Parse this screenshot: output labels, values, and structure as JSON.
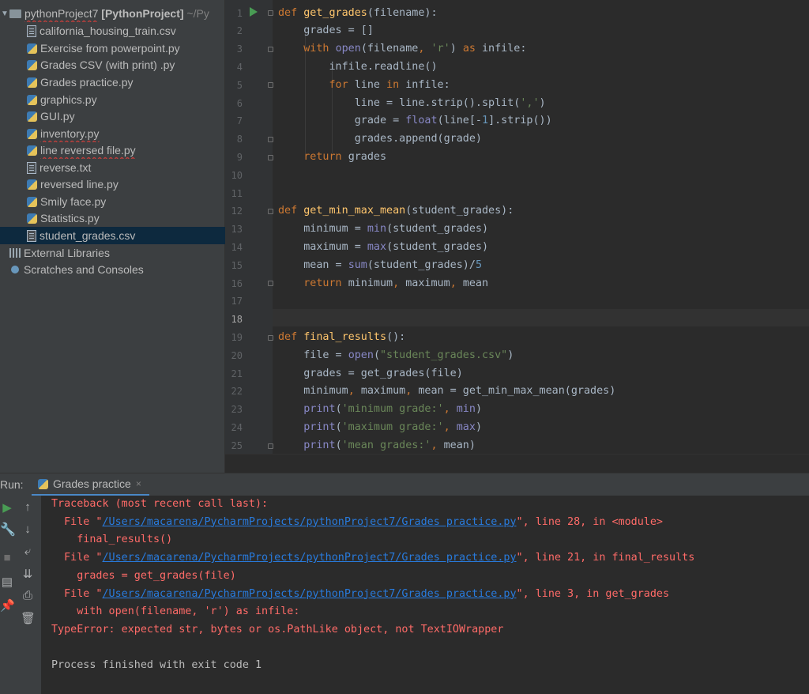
{
  "project": {
    "root": {
      "name": "pythonProject7",
      "label": "[PythonProject]",
      "path": "~/Py"
    },
    "items": [
      {
        "name": "california_housing_train.csv",
        "type": "csv"
      },
      {
        "name": "Exercise from powerpoint.py",
        "type": "py"
      },
      {
        "name": "Grades CSV (with print) .py",
        "type": "py"
      },
      {
        "name": "Grades practice.py",
        "type": "py"
      },
      {
        "name": "graphics.py",
        "type": "py"
      },
      {
        "name": "GUI.py",
        "type": "py"
      },
      {
        "name": "inventory.py",
        "type": "py"
      },
      {
        "name": "line reversed file.py",
        "type": "py"
      },
      {
        "name": "reverse.txt",
        "type": "txt"
      },
      {
        "name": "reversed line.py",
        "type": "py"
      },
      {
        "name": "Smily face.py",
        "type": "py"
      },
      {
        "name": "Statistics.py",
        "type": "py"
      },
      {
        "name": "student_grades.csv",
        "type": "csv",
        "selected": true
      }
    ],
    "external_libraries": "External Libraries",
    "scratches": "Scratches and Consoles"
  },
  "editor": {
    "line_numbers": [
      "1",
      "2",
      "3",
      "4",
      "5",
      "6",
      "7",
      "8",
      "9",
      "10",
      "11",
      "12",
      "13",
      "14",
      "15",
      "16",
      "17",
      "18",
      "19",
      "20",
      "21",
      "22",
      "23",
      "24",
      "25"
    ],
    "current_line": "18"
  },
  "run": {
    "title": "Run:",
    "tab": "Grades practice",
    "tab_close": "×",
    "output": {
      "traceback": "Traceback (most recent call last):",
      "file_prefix": "  File \"",
      "path": "/Users/macarena/PycharmProjects/pythonProject7/Grades practice.py",
      "frame1_suffix": "\", line 28, in <module>",
      "frame1_code": "    final_results()",
      "frame2_suffix": "\", line 21, in final_results",
      "frame2_code": "    grades = get_grades(file)",
      "frame3_suffix": "\", line 3, in get_grades",
      "frame3_code": "    with open(filename, 'r') as infile:",
      "error": "TypeError: expected str, bytes or os.PathLike object, not TextIOWrapper",
      "finished": "Process finished with exit code 1"
    }
  },
  "colors": {
    "keyword": "#cc7832",
    "function_name": "#ffc66d",
    "builtin": "#8888c6",
    "string": "#6a8759",
    "number": "#6897bb",
    "error_text": "#ff6b68",
    "link": "#287bde",
    "selection": "#0d293e"
  }
}
